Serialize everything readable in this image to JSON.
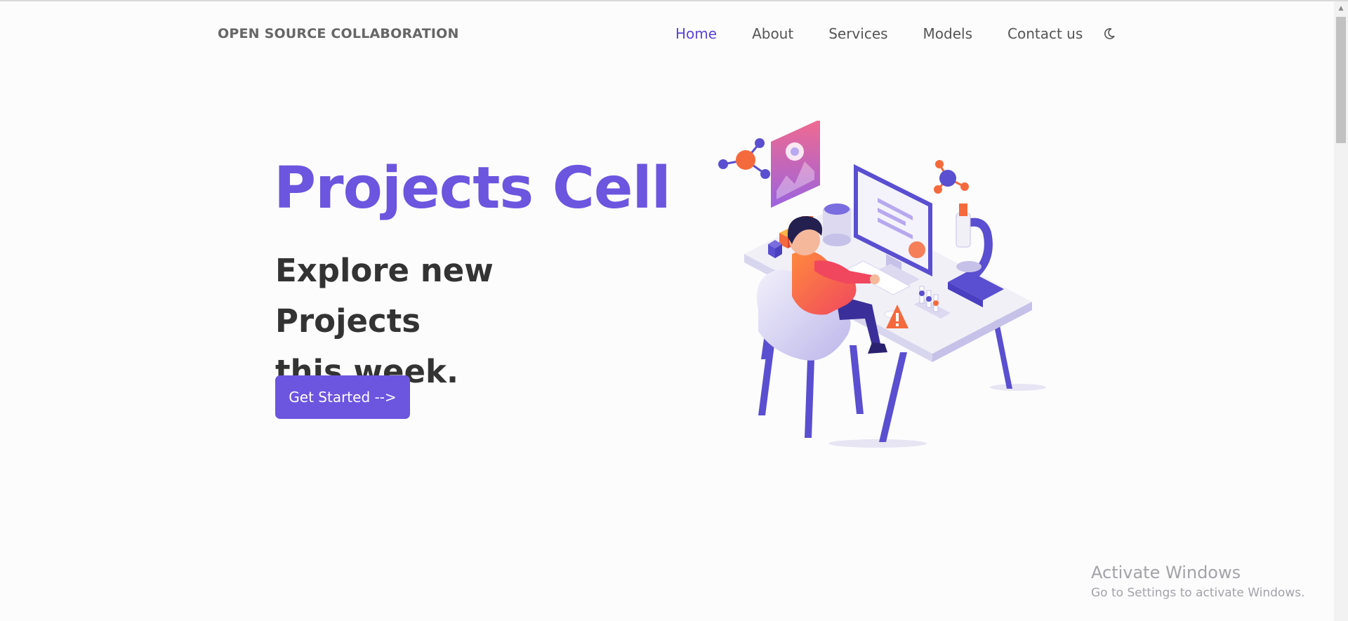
{
  "navbar": {
    "brand": "OPEN SOURCE COLLABORATION",
    "links": [
      {
        "label": "Home",
        "active": true
      },
      {
        "label": "About",
        "active": false
      },
      {
        "label": "Services",
        "active": false
      },
      {
        "label": "Models",
        "active": false
      },
      {
        "label": "Contact us",
        "active": false
      }
    ],
    "theme_toggle_icon": "moon-icon"
  },
  "hero": {
    "title": "Projects Cell",
    "subtitle_line1": "Explore new Projects",
    "subtitle_line2": "this week.",
    "cta_label": "Get Started -->",
    "illustration": "isometric-desk-workspace-illustration"
  },
  "watermark": {
    "title": "Activate Windows",
    "subtitle": "Go to Settings to activate Windows."
  },
  "colors": {
    "accent": "#6c55df",
    "nav_active": "#5b45d6",
    "heading_dark": "#333333",
    "background": "#fcfcfd"
  }
}
